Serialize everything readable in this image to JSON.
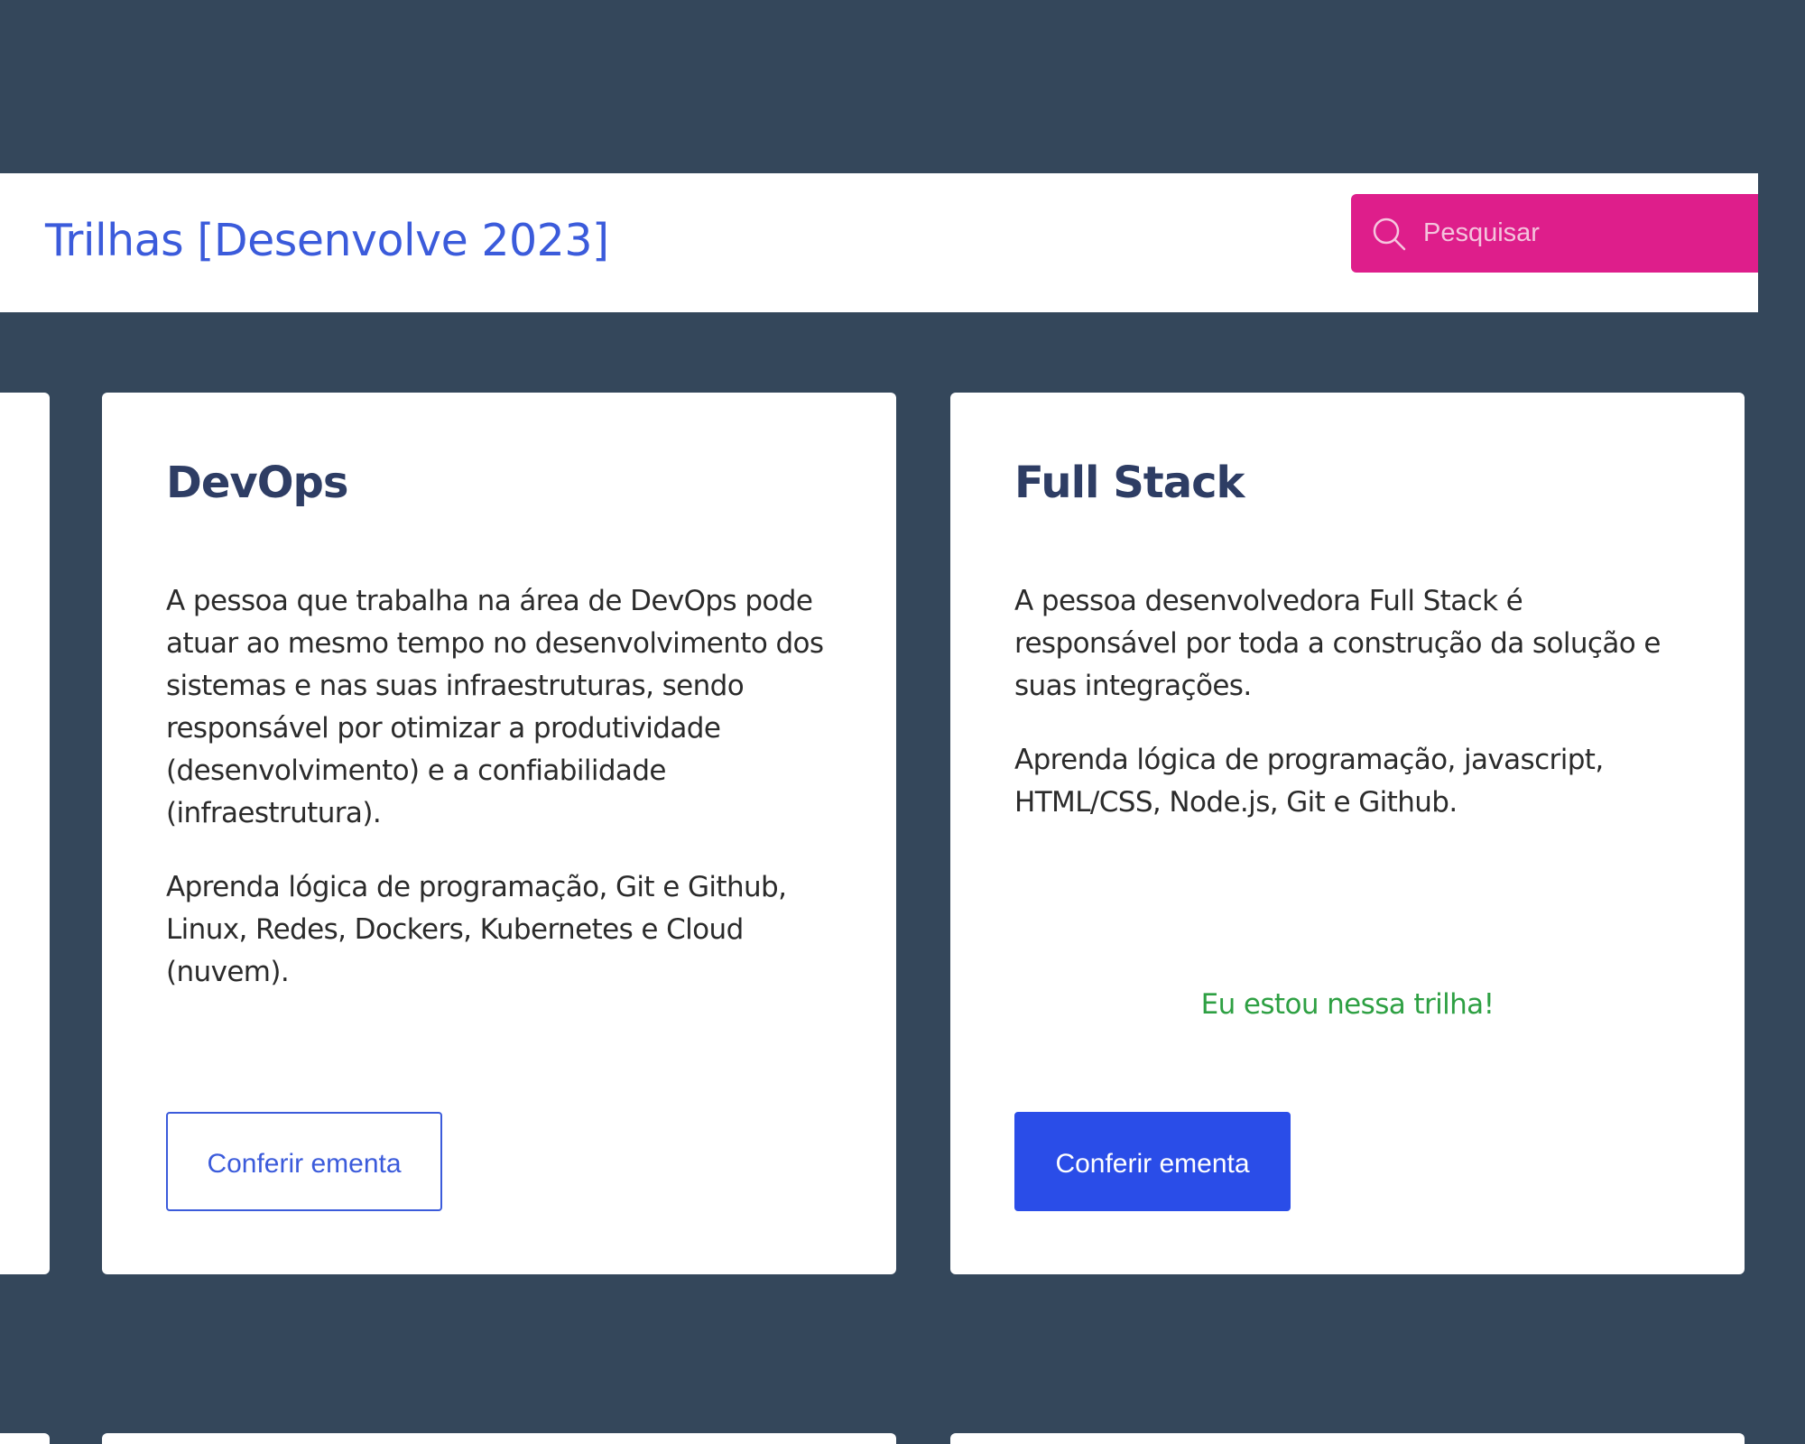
{
  "header": {
    "title": "Trilhas [Desenvolve 2023]",
    "search": {
      "placeholder": "Pesquisar",
      "value": "",
      "icon": "search-icon"
    }
  },
  "cards": [
    {
      "title": "DevOps",
      "paragraphs": [
        "A pessoa que trabalha na área de DevOps pode atuar ao mesmo tempo no desenvolvimento dos sistemas e nas suas infraestruturas, sendo responsável por otimizar a produtividade (desenvolvimento) e a confiabilidade (infraestrutura).",
        "Aprenda lógica de programação, Git e Github, Linux, Redes, Dockers, Kubernetes e Cloud (nuvem)."
      ],
      "status": "",
      "button_label": "Conferir ementa",
      "button_style": "outline"
    },
    {
      "title": "Full Stack",
      "paragraphs": [
        "A pessoa desenvolvedora Full Stack é responsável por toda a construção da solução e suas integrações.",
        "Aprenda lógica de programação, javascript, HTML/CSS, Node.js, Git e Github."
      ],
      "status": "Eu estou nessa trilha!",
      "button_label": "Conferir ementa",
      "button_style": "filled"
    }
  ],
  "colors": {
    "page_background": "#34475b",
    "title_blue": "#3b5bdb",
    "search_pink": "#de1e8b",
    "card_title": "#2e3d64",
    "status_green": "#2ea043",
    "button_blue": "#2a4de8"
  }
}
